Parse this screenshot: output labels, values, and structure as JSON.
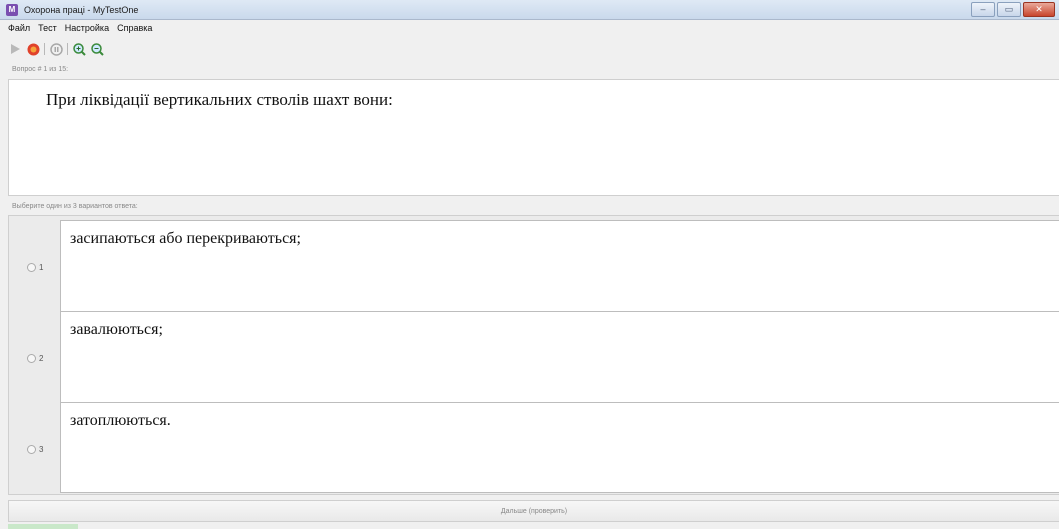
{
  "window": {
    "title": "Охорона праці - MyTestOne"
  },
  "menu": [
    "Файл",
    "Тест",
    "Настройка",
    "Справка"
  ],
  "toolbar": {
    "icons": [
      "play-icon",
      "stop-icon",
      "pause-icon",
      "zoom-in-icon",
      "zoom-out-icon"
    ]
  },
  "question": {
    "counter": "Вопрос # 1 из 15:",
    "text": "При ліквідації вертикальних стволів шахт вони:"
  },
  "answers_hint": "Выберите один из 3 вариантов ответа:",
  "answers": [
    {
      "number": "1",
      "text": "засипаються або перекриваються;"
    },
    {
      "number": "2",
      "text": "завалюються;"
    },
    {
      "number": "3",
      "text": "затоплюються."
    }
  ],
  "next_button": "Дальше (проверить)"
}
